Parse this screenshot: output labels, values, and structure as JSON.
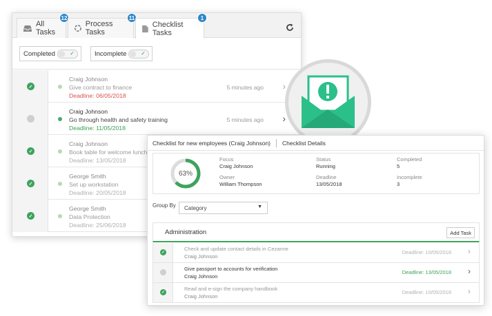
{
  "back_panel": {
    "tabs": [
      {
        "label": "All Tasks",
        "badge": "12",
        "icon": "inbox-icon"
      },
      {
        "label": "Process Tasks",
        "badge": "11",
        "icon": "process-icon"
      },
      {
        "label": "Checklist Tasks",
        "badge": "1",
        "icon": "document-icon"
      }
    ],
    "filters": [
      {
        "label": "Completed"
      },
      {
        "label": "Incomplete"
      }
    ],
    "tasks": [
      {
        "name": "Craig Johnson",
        "description": "Give contract to finance",
        "deadline": "Deadline: 06/05/2018",
        "time": "5 minutes ago",
        "completed": true,
        "deadline_color": "red"
      },
      {
        "name": "Craig Johnson",
        "description": "Go through health and safety training",
        "deadline": "Deadline: 11/05/2018",
        "time": "5 minutes ago",
        "completed": false,
        "deadline_color": "green"
      },
      {
        "name": "Craig Johnson",
        "description": "Book table for welcome lunch",
        "deadline": "Deadline: 13/05/2018",
        "time": "",
        "completed": true,
        "deadline_color": "grey"
      },
      {
        "name": "George Smith",
        "description": "Set up workstation",
        "deadline": "Deadline: 20/05/2018",
        "time": "",
        "completed": true,
        "deadline_color": "grey"
      },
      {
        "name": "George Smith",
        "description": "Data Protection",
        "deadline": "Deadline: 25/06/2018",
        "time": "",
        "completed": true,
        "deadline_color": "grey"
      }
    ]
  },
  "front_panel": {
    "title": "Checklist for new employees (Craig Johnson)",
    "details_link": "Checklist Details",
    "progress": 63,
    "progress_label": "63%",
    "summary": {
      "focus_label": "Focus",
      "focus_value": "Craig Johnson",
      "owner_label": "Owner",
      "owner_value": "William Thompson",
      "status_label": "Status",
      "status_value": "Running",
      "deadline_label": "Deadline",
      "deadline_value": "13/05/2018",
      "completed_label": "Completed",
      "completed_value": "5",
      "incomplete_label": "Incomplete",
      "incomplete_value": "3"
    },
    "group_by_label": "Group By",
    "group_by_value": "Category",
    "section_title": "Administration",
    "add_task_label": "Add Task",
    "tasks": [
      {
        "title": "Check and update contact details in Cezanne",
        "assignee": "Craig Johnson",
        "deadline": "Deadline: 10/05/2018",
        "completed": true
      },
      {
        "title": "Give passport to accounts for verification",
        "assignee": "Craig Johnson",
        "deadline": "Deadline: 13/05/2018",
        "completed": false
      },
      {
        "title": "Read and e-sign the company handbook",
        "assignee": "Craig Johnson",
        "deadline": "Deadline: 10/05/2018",
        "completed": true
      }
    ]
  },
  "colors": {
    "accent_green": "#3da35d",
    "badge_blue": "#2e86c9",
    "mail_icon_green": "#2bbf8a",
    "overdue_red": "#d9534f"
  }
}
